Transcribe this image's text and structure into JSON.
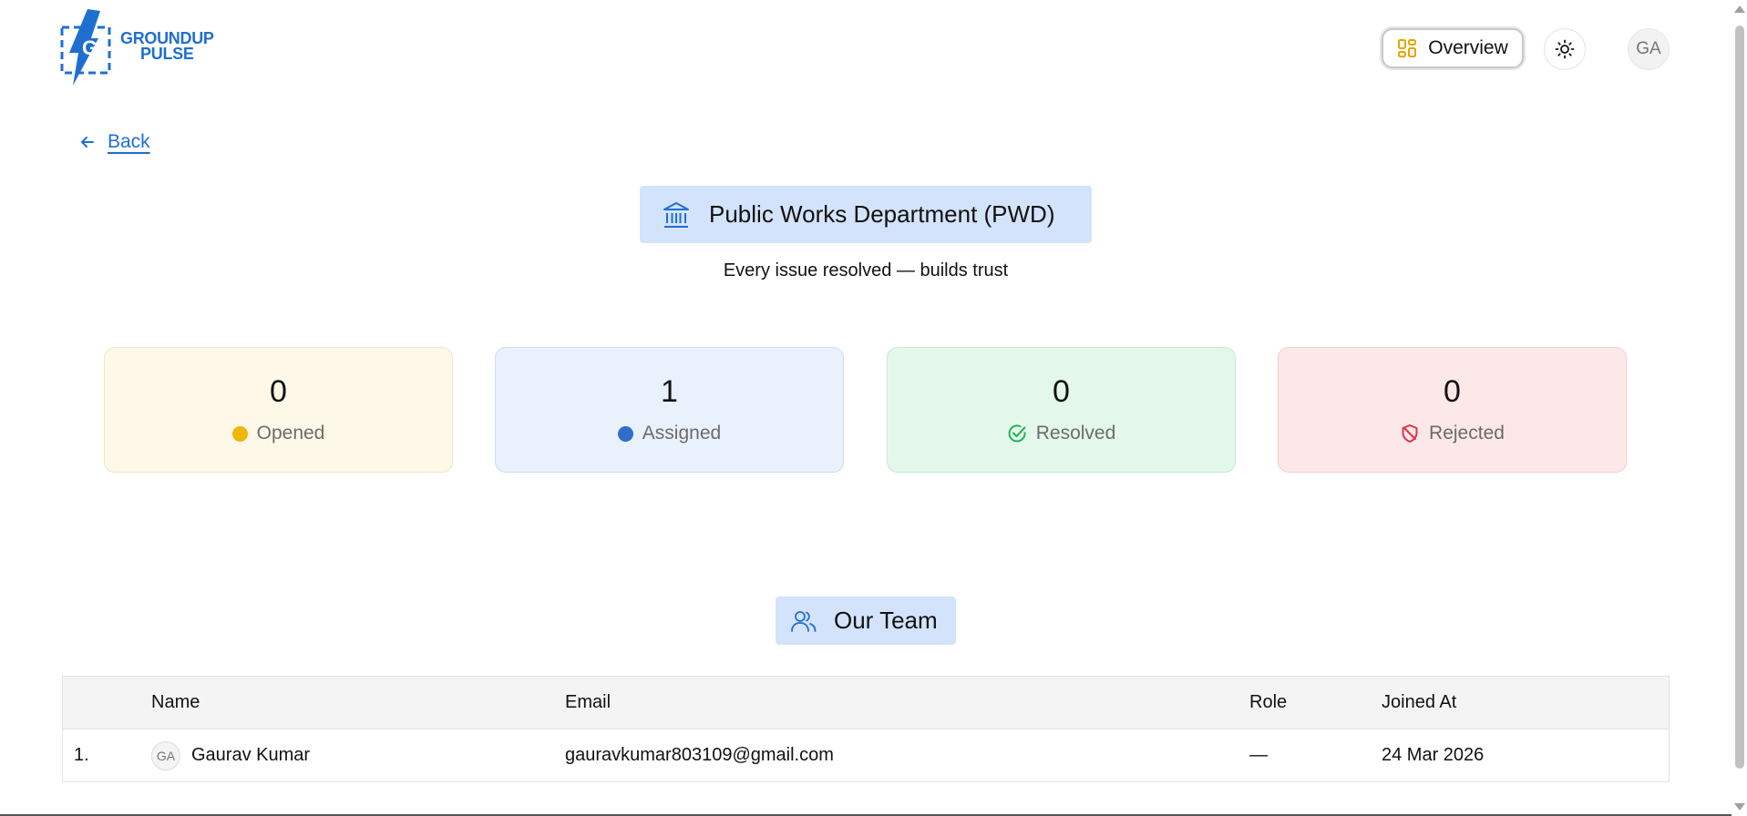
{
  "header": {
    "logo_line1": "GROUNDUP",
    "logo_line2": "PULSE",
    "overview_label": "Overview",
    "avatar_initials": "GA"
  },
  "nav": {
    "back_label": "Back"
  },
  "department": {
    "title": "Public Works Department (PWD)",
    "tagline": "Every issue resolved — builds trust"
  },
  "stats": [
    {
      "value": "0",
      "label": "Opened",
      "color": "#f2b705"
    },
    {
      "value": "1",
      "label": "Assigned",
      "color": "#2f6fc9"
    },
    {
      "value": "0",
      "label": "Resolved",
      "color": "#22b356"
    },
    {
      "value": "0",
      "label": "Rejected",
      "color": "#e0344b"
    }
  ],
  "team": {
    "title": "Our Team",
    "columns": [
      "Name",
      "Email",
      "Role",
      "Joined At"
    ],
    "rows": [
      {
        "index": "1.",
        "avatar": "GA",
        "name": "Gaurav Kumar",
        "email": "gauravkumar803109@gmail.com",
        "role": "—",
        "joined": "24 Mar 2026"
      }
    ]
  },
  "colors": {
    "brand": "#1f6fd0",
    "title_bg": "#d3e3fb"
  }
}
